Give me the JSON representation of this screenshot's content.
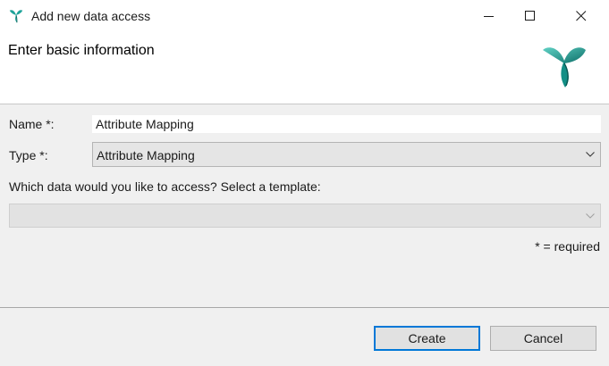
{
  "window": {
    "title": "Add new data access",
    "app_icon": "ribbon-logo-icon",
    "controls": [
      "minimize-icon",
      "maximize-icon",
      "close-icon"
    ]
  },
  "header": {
    "title": "Enter basic information",
    "logo": "ribbon-logo-icon"
  },
  "form": {
    "name_label": "Name *:",
    "name_value": "Attribute Mapping",
    "type_label": "Type *:",
    "type_value": "Attribute Mapping",
    "template_question": "Which data would you like to access? Select a template:",
    "template_value": "",
    "required_note": "* = required"
  },
  "buttons": {
    "create": "Create",
    "cancel": "Cancel"
  },
  "colors": {
    "accent": "#0078d7",
    "logo_teal": "#1fa39a",
    "background": "#f0f0f0"
  }
}
